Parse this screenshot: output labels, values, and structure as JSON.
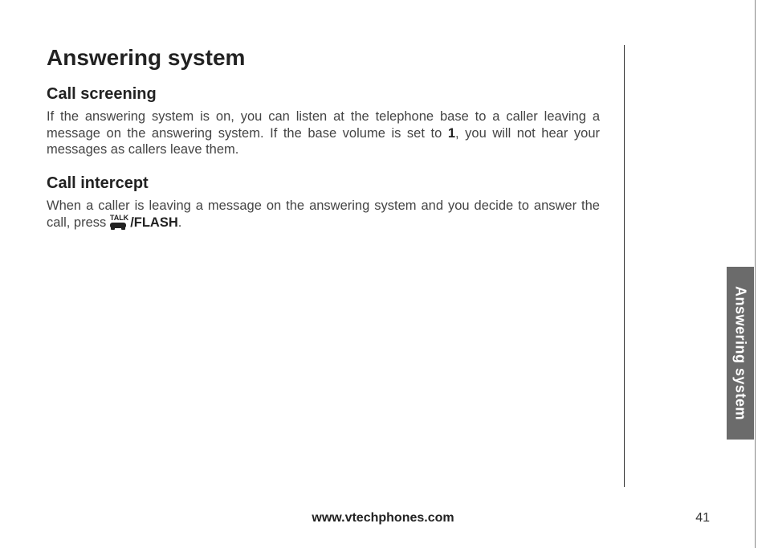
{
  "main_title": "Answering system",
  "section1": {
    "title": "Call screening",
    "text_part1": "If the answering system is on, you can listen at the telephone base to a caller leaving a message on the answering system. If the base volume is set to ",
    "bold1": "1",
    "text_part2": ", you will not hear your messages as callers leave them."
  },
  "section2": {
    "title": "Call intercept",
    "text_part1": "When a caller is leaving a message on the answering system and you decide to answer the call, press ",
    "talk_label": "TALK",
    "flash_label": "/FLASH",
    "text_part2": "."
  },
  "side_tab": "Answering system",
  "footer_url": "www.vtechphones.com",
  "page_number": "41"
}
